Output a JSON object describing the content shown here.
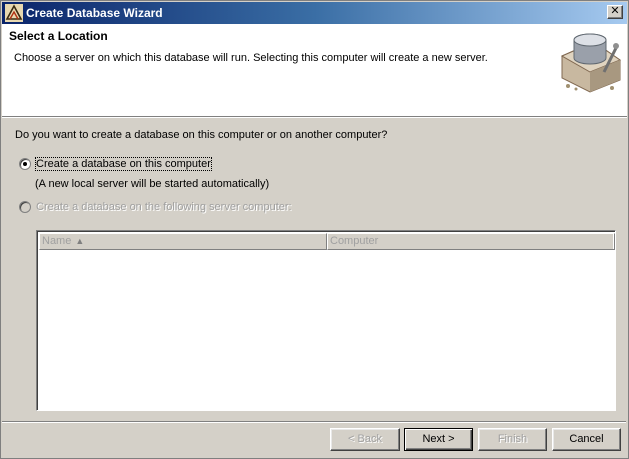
{
  "window": {
    "title": "Create Database Wizard",
    "close_label": "✕"
  },
  "header": {
    "title": "Select a Location",
    "description": "Choose a server on which this database will run. Selecting this computer will create a new server."
  },
  "body": {
    "question": "Do you want to create a database on this computer or on another computer?",
    "option_local": {
      "label": "Create a database on this computer",
      "selected": true
    },
    "option_local_note": "(A new local server will be started automatically)",
    "option_remote": {
      "label": "Create a database on the following server computer:",
      "selected": false,
      "enabled": false
    },
    "server_list": {
      "columns": [
        "Name",
        "Computer"
      ],
      "sort_indicator": "▲",
      "rows": []
    }
  },
  "buttons": {
    "back": {
      "label": "< Back",
      "enabled": false
    },
    "next": {
      "label": "Next >",
      "enabled": true
    },
    "finish": {
      "label": "Finish",
      "enabled": false
    },
    "cancel": {
      "label": "Cancel",
      "enabled": true
    }
  },
  "colors": {
    "titlebar_start": "#0a246a",
    "titlebar_end": "#a6caf0",
    "dialog_face": "#d4d0c8",
    "disabled_text": "#a0a0a0"
  }
}
